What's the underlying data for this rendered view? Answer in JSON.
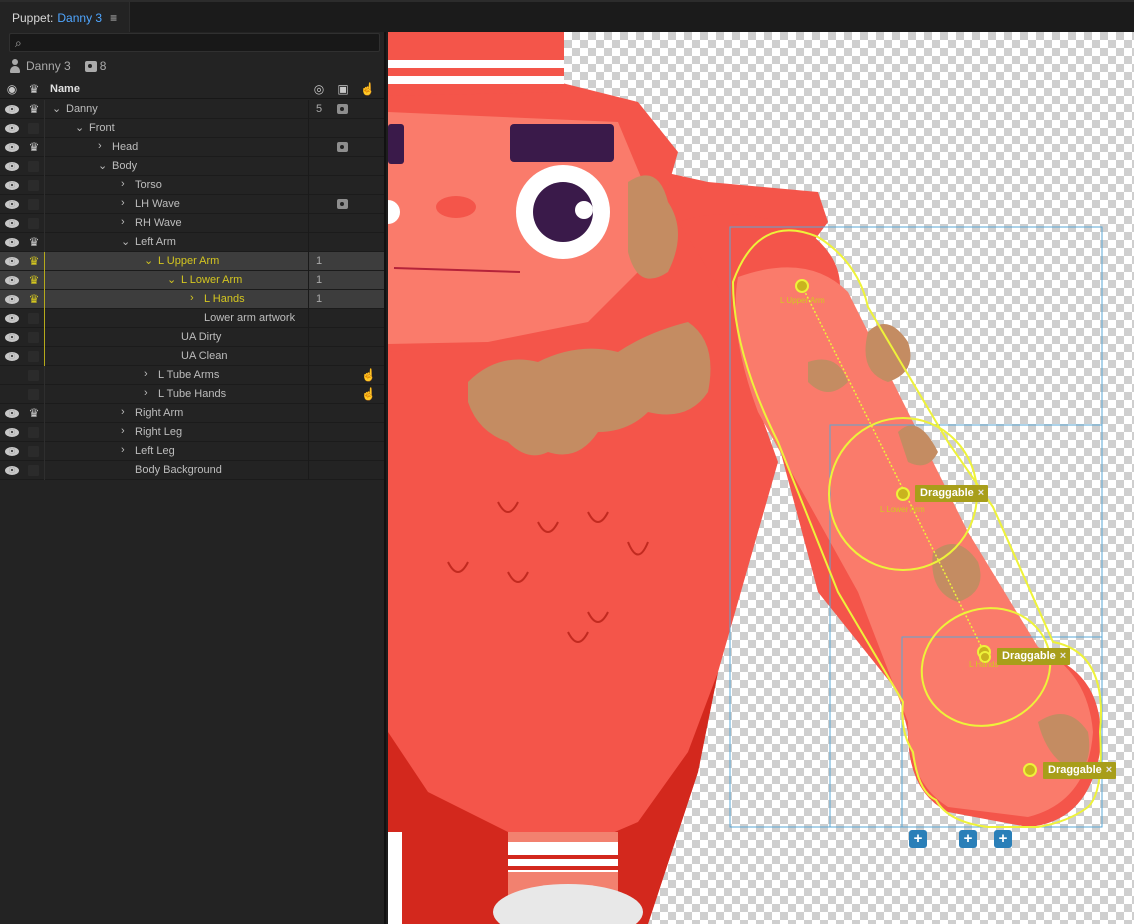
{
  "panel_title": {
    "prefix": "Puppet:",
    "name": "Danny 3",
    "menu_icon": "hamburger-icon"
  },
  "search": {
    "placeholder": "",
    "icon": "search-icon"
  },
  "puppet_info": {
    "name": "Danny 3",
    "camera_count": "8"
  },
  "table_header": {
    "name_label": "Name"
  },
  "rows": [
    {
      "label": "Danny",
      "num": "5",
      "cam": true
    },
    {
      "label": "Front"
    },
    {
      "label": "Head",
      "cam": true
    },
    {
      "label": "Body"
    },
    {
      "label": "Torso"
    },
    {
      "label": "LH Wave",
      "cam": true
    },
    {
      "label": "RH Wave"
    },
    {
      "label": "Left Arm"
    },
    {
      "label": "L Upper Arm",
      "num": "1"
    },
    {
      "label": "L Lower Arm",
      "num": "1"
    },
    {
      "label": "L Hands",
      "num": "1"
    },
    {
      "label": "Lower arm artwork"
    },
    {
      "label": "UA Dirty"
    },
    {
      "label": "UA Clean"
    },
    {
      "label": "L Tube Arms",
      "hand": true
    },
    {
      "label": "L Tube Hands",
      "hand": true
    },
    {
      "label": "Right Arm"
    },
    {
      "label": "Right Leg"
    },
    {
      "label": "Left Leg"
    },
    {
      "label": "Body Background"
    }
  ],
  "canvas": {
    "handles": [
      {
        "label": "Draggable",
        "close": "×"
      },
      {
        "label": "Draggable",
        "close": "×"
      },
      {
        "label": "Draggable",
        "close": "×"
      }
    ],
    "tiny_labels": [
      "L Upper Arm",
      "L Lower Arm",
      "L Hands"
    ],
    "plus_buttons": [
      "+",
      "+",
      "+"
    ]
  },
  "colors": {
    "accent": "#4fa6ff",
    "selected_text": "#d4c620",
    "handle_bg": "#a89e1a",
    "character": "#f4554a"
  }
}
